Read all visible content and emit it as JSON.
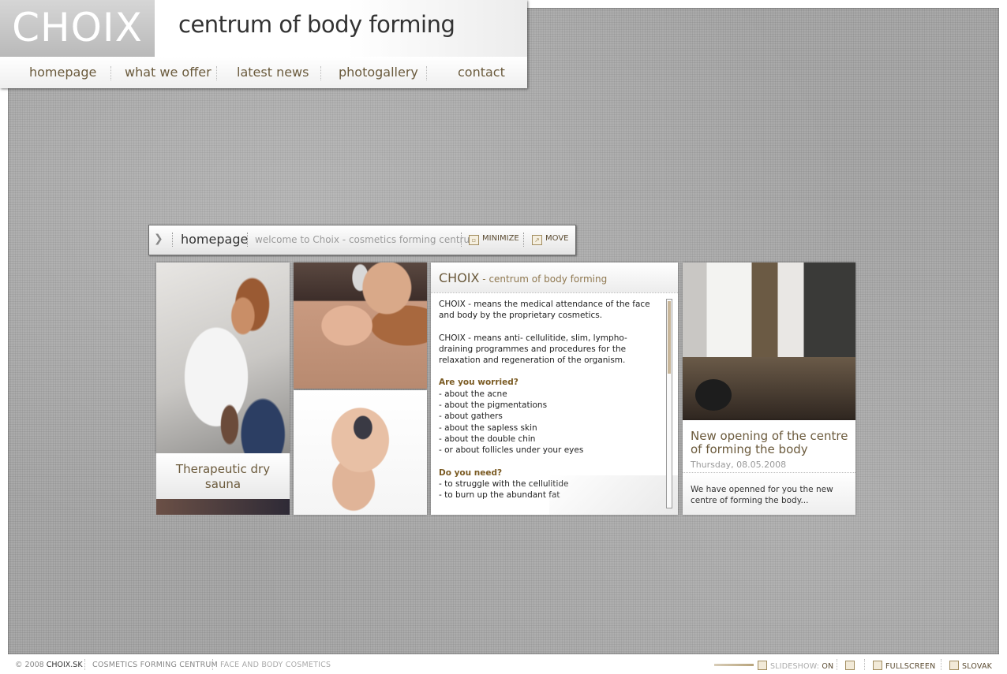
{
  "header": {
    "logo": "CHOIX",
    "tagline": "centrum of body forming",
    "nav": [
      "homepage",
      "what we offer",
      "latest news",
      "photogallery",
      "contact"
    ]
  },
  "window": {
    "title": "homepage",
    "subtitle": "welcome to Choix - cosmetics forming centrum",
    "minimize_label": "MINIMIZE",
    "move_label": "MOVE"
  },
  "sauna": {
    "caption_line1": "Therapeutic dry",
    "caption_line2": "sauna"
  },
  "intro": {
    "brand": "CHOIX",
    "brand_sub": " - centrum of body forming",
    "p1": "CHOIX - means the medical attendance of the face and body by the proprietary cosmetics.",
    "p2": "CHOIX - means anti- cellulitide, slim, lympho- draining programmes and procedures for the relaxation and regeneration of the organism.",
    "h1": "Are you worried?",
    "worries": [
      "- about the acne",
      "- about the pigmentations",
      "- about gathers",
      "- about the sapless skin",
      "- about the double chin",
      "- or about follicles under your eyes"
    ],
    "h2": "Do you need?",
    "needs": [
      "- to struggle with the cellulitide",
      "- to burn up the abundant fat"
    ]
  },
  "news": {
    "title": "New opening of the centre of forming the body",
    "date": "Thursday, 08.05.2008",
    "excerpt": "We have openned for you the new centre of forming the body..."
  },
  "footer": {
    "copyright_prefix": "© 2008 ",
    "copyright_site": "CHOIX.SK",
    "link1": "COSMETICS FORMING CENTRUM",
    "link2": "FACE AND BODY COSMETICS",
    "slideshow_label": "SLIDESHOW: ",
    "slideshow_state": "ON",
    "fullscreen_label": "FULLSCREEN",
    "language_label": "SLOVAK"
  },
  "colors": {
    "accent": "#6b5a3c",
    "heading_gold": "#7a5a22"
  }
}
